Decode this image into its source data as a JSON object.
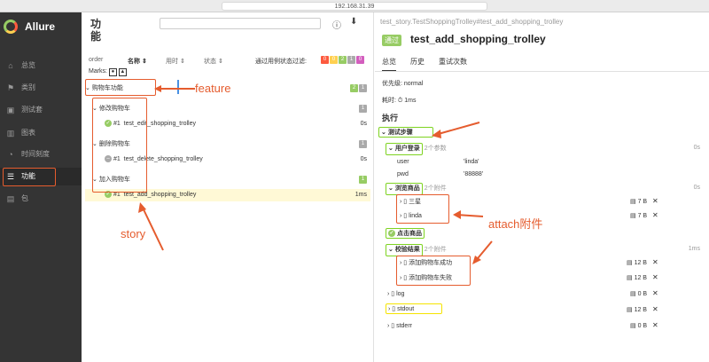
{
  "browser": {
    "url": "192.168.31.39"
  },
  "sidebar": {
    "brand": "Allure",
    "items": [
      {
        "label": "总览",
        "icon": "home-icon"
      },
      {
        "label": "类别",
        "icon": "flag-icon"
      },
      {
        "label": "测试套",
        "icon": "briefcase-icon"
      },
      {
        "label": "图表",
        "icon": "bar-chart-icon"
      },
      {
        "label": "时间刻度",
        "icon": "clock-icon"
      },
      {
        "label": "功能",
        "icon": "list-icon"
      },
      {
        "label": "包",
        "icon": "package-icon"
      }
    ],
    "active_index": 5
  },
  "middle": {
    "title": "功能",
    "columns": {
      "order": "order",
      "name": "名称",
      "duration": "用时",
      "status": "状态"
    },
    "status_filter_label": "通过用例状态过滤:",
    "status_filters": [
      {
        "value": "0",
        "color": "#fd5a3e"
      },
      {
        "value": "0",
        "color": "#ffd050"
      },
      {
        "value": "2",
        "color": "#97cc64"
      },
      {
        "value": "1",
        "color": "#aaaaaa"
      },
      {
        "value": "0",
        "color": "#d35ebe"
      }
    ],
    "marks_label": "Marks:",
    "feature": {
      "name": "购物车功能",
      "counts": [
        {
          "value": "2",
          "color": "#97cc64"
        },
        {
          "value": "1",
          "color": "#aaaaaa"
        }
      ]
    },
    "stories": [
      {
        "name": "修改购物车",
        "count": "1",
        "count_color": "#aaaaaa",
        "test": {
          "index": "#1",
          "name": "test_edit_shopping_trolley",
          "duration": "0s",
          "status": "passed"
        }
      },
      {
        "name": "删除购物车",
        "count": "1",
        "count_color": "#aaaaaa",
        "test": {
          "index": "#1",
          "name": "test_delete_shopping_trolley",
          "duration": "0s",
          "status": "skipped"
        }
      },
      {
        "name": "加入购物车",
        "count": "1",
        "count_color": "#97cc64",
        "test": {
          "index": "#1",
          "name": "test_add_shopping_trolley",
          "duration": "1ms",
          "status": "passed"
        }
      }
    ]
  },
  "right": {
    "breadcrumb": "test_story.TestShoppingTrolley#test_add_shopping_trolley",
    "status_badge": "通过",
    "title": "test_add_shopping_trolley",
    "tabs": [
      "总览",
      "历史",
      "重试次数"
    ],
    "priority": "优先级: normal",
    "duration": "耗时: ⏱ 1ms",
    "exec_label": "执行",
    "steps_label": "测试步骤",
    "step1": {
      "name": "用户登录",
      "meta": "2个参数",
      "dur": "0s",
      "params": [
        {
          "k": "user",
          "v": "'linda'"
        },
        {
          "k": "pwd",
          "v": "'88888'"
        }
      ]
    },
    "step2": {
      "name": "浏览商品",
      "meta": "2个附件",
      "dur": "0s",
      "attachments": [
        {
          "name": "三星",
          "size": "7 B"
        },
        {
          "name": "linda",
          "size": "7 B"
        }
      ]
    },
    "step3": {
      "name": "点击商品"
    },
    "step4": {
      "name": "校验结果",
      "meta": "2个附件",
      "dur": "1ms",
      "attachments": [
        {
          "name": "添加购物车成功",
          "size": "12 B"
        },
        {
          "name": "添加购物车失败",
          "size": "12 B"
        }
      ]
    },
    "files": [
      {
        "name": "log",
        "size": "0 B"
      },
      {
        "name": "stdout",
        "size": "12 B"
      },
      {
        "name": "stderr",
        "size": "0 B"
      }
    ]
  },
  "annotations": {
    "feature": "feature",
    "story": "story",
    "attach": "attach附件"
  }
}
